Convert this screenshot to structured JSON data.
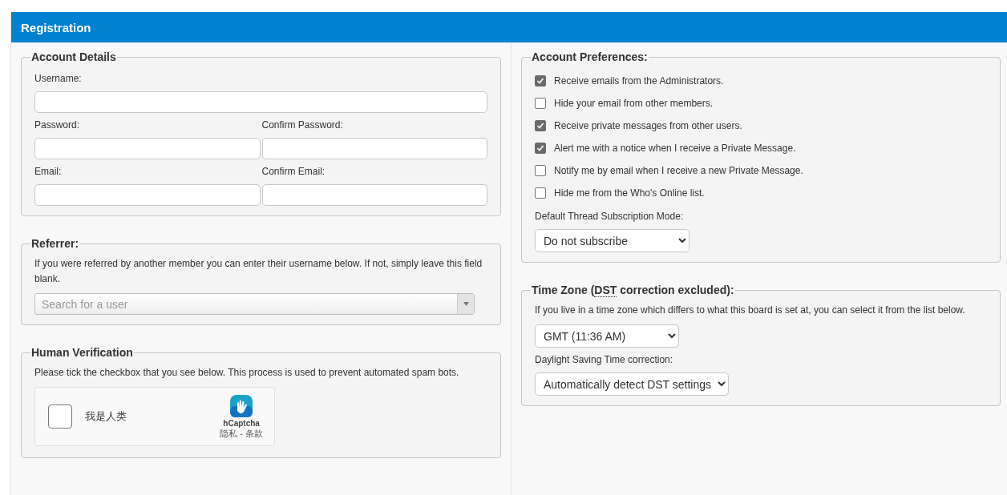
{
  "header": {
    "title": "Registration"
  },
  "account_details": {
    "title": "Account Details",
    "fields": [
      {
        "label": "Username:",
        "kind": "wide"
      },
      {
        "label": "Password:",
        "kind": "half"
      },
      {
        "label": "Confirm Password:",
        "kind": "half"
      },
      {
        "label": "Email:",
        "kind": "half"
      },
      {
        "label": "Confirm Email:",
        "kind": "half"
      }
    ]
  },
  "referrer": {
    "title": "Referrer:",
    "description": "If you were referred by another member you can enter their username below. If not, simply leave this field blank.",
    "search": {
      "placeholder": "Search for a user"
    }
  },
  "human_verification": {
    "title": "Human Verification",
    "description": "Please tick the checkbox that you see below. This process is used to prevent automated spam bots.",
    "captcha": {
      "checked": false,
      "label": "我是人类",
      "brand": "hCaptcha",
      "links": "隐私 - 条款"
    }
  },
  "account_preferences": {
    "title": "Account Preferences:",
    "options": [
      {
        "label": "Receive emails from the Administrators.",
        "checked": true
      },
      {
        "label": "Hide your email from other members.",
        "checked": false
      },
      {
        "label": "Receive private messages from other users.",
        "checked": true
      },
      {
        "label": "Alert me with a notice when I receive a Private Message.",
        "checked": true
      },
      {
        "label": "Notify me by email when I receive a new Private Message.",
        "checked": false
      },
      {
        "label": "Hide me from the Who's Online list.",
        "checked": false
      }
    ],
    "subscription_label": "Default Thread Subscription Mode:",
    "subscription_value": "Do not subscribe"
  },
  "time_zone": {
    "title_parts": [
      {
        "kind": "plain",
        "text": "Time Zone ("
      },
      {
        "kind": "abbr",
        "text": "DST"
      },
      {
        "kind": "plain",
        "text": " correction excluded):"
      }
    ],
    "description": "If you live in a time zone which differs to what this board is set at, you can select it from the list below.",
    "zone_value": "GMT (11:36 AM)",
    "dst_label": "Daylight Saving Time correction:",
    "dst_value": "Automatically detect DST settings"
  }
}
